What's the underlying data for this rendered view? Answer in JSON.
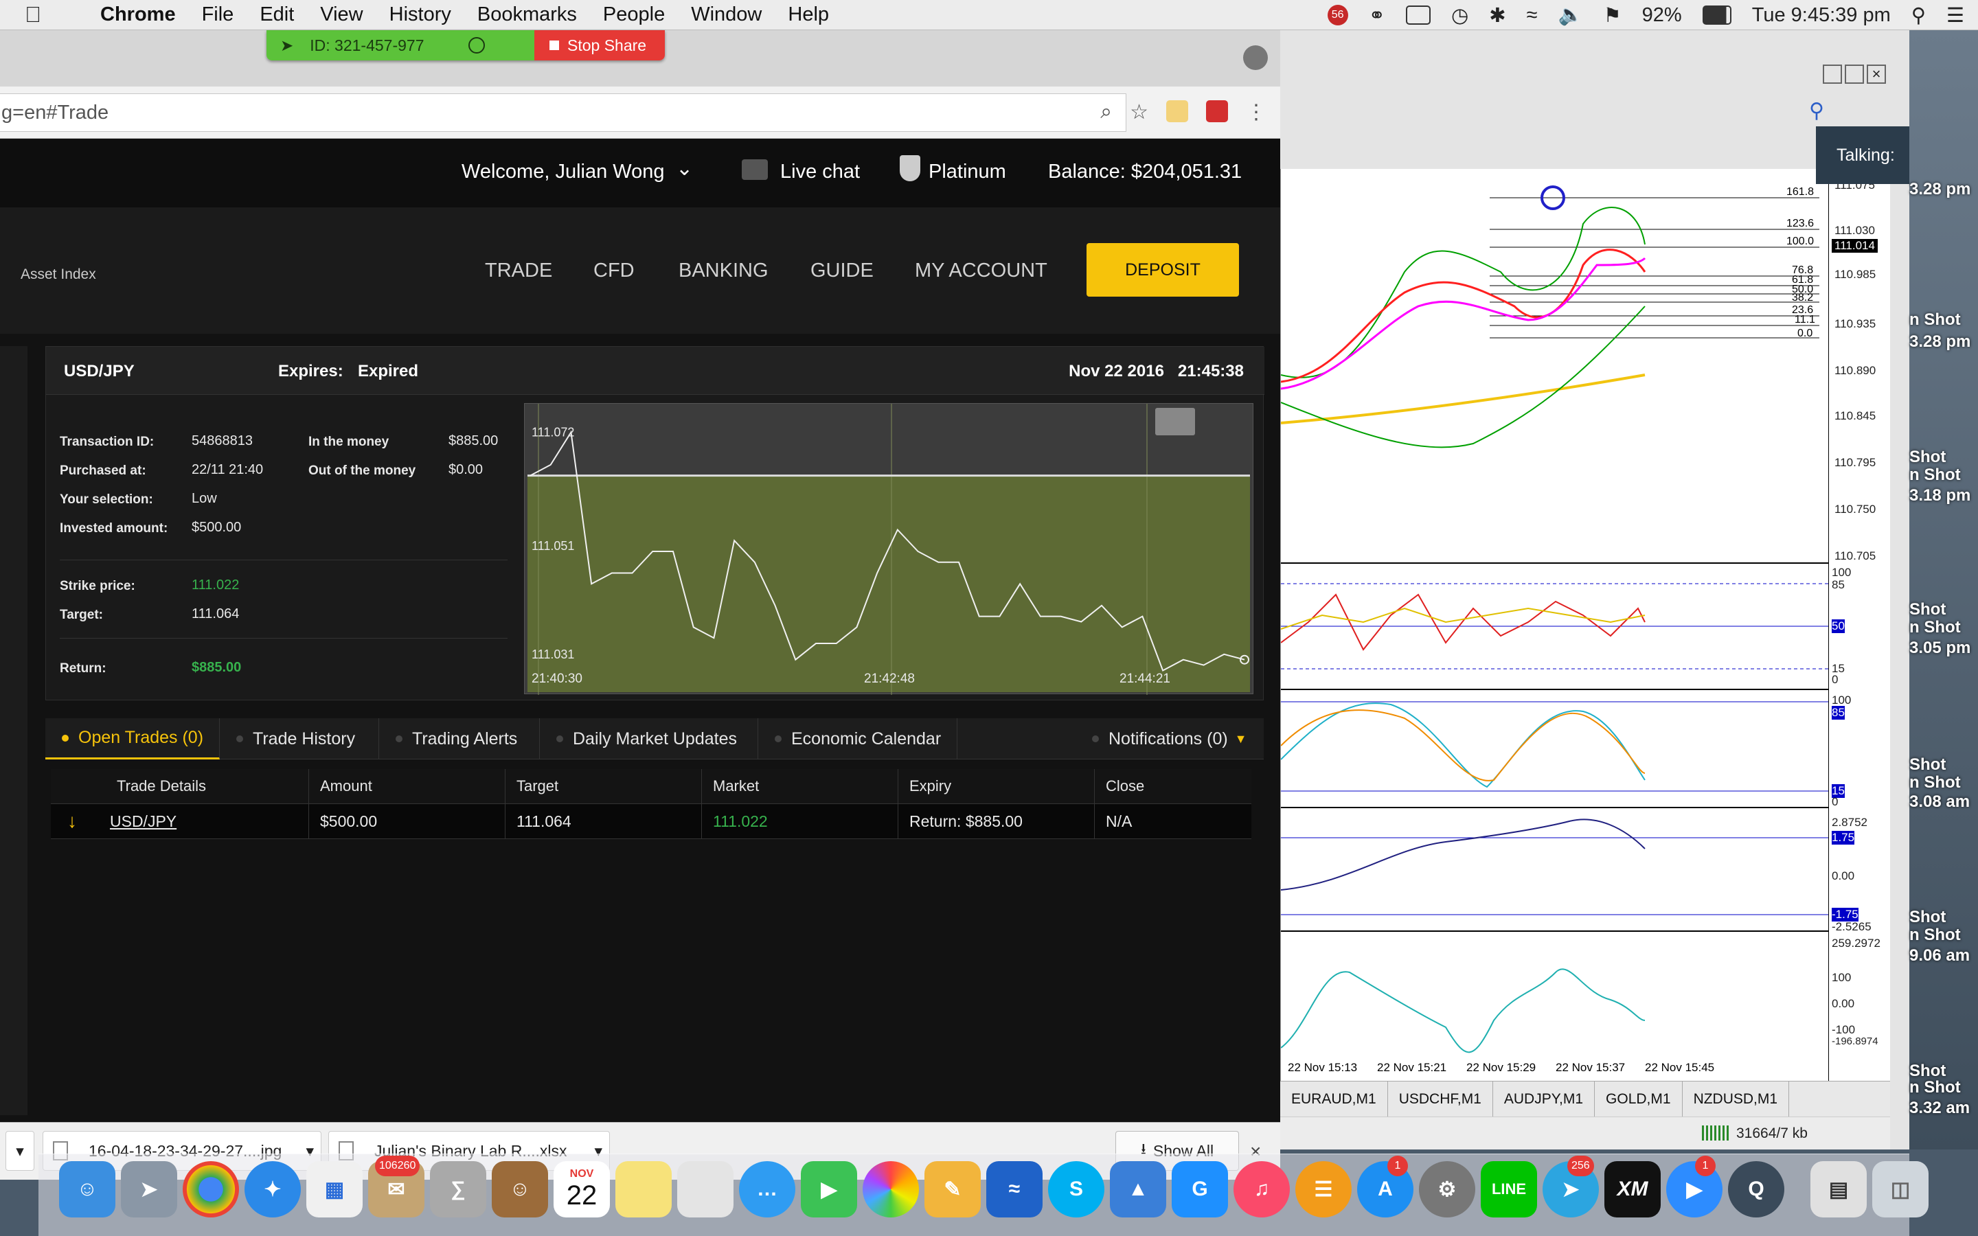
{
  "menubar": {
    "app": "Chrome",
    "items": [
      "File",
      "Edit",
      "View",
      "History",
      "Bookmarks",
      "People",
      "Window",
      "Help"
    ],
    "battery": "92%",
    "clock": "Tue 9:45:39 pm",
    "badge": "56"
  },
  "screen_share": {
    "id_label": "ID: 321-457-977",
    "stop_label": "Stop Share"
  },
  "browser": {
    "url": "g=en#Trade"
  },
  "site": {
    "welcome": "Welcome, Julian Wong",
    "live_chat": "Live chat",
    "tier": "Platinum",
    "balance": "Balance: $204,051.31",
    "asset_index": "Asset Index",
    "nav": [
      "TRADE",
      "CFD",
      "BANKING",
      "GUIDE",
      "MY ACCOUNT"
    ],
    "deposit": "DEPOSIT"
  },
  "trade_card": {
    "pair": "USD/JPY",
    "expires_label": "Expires:",
    "expires_value": "Expired",
    "datetime": "Nov 22 2016   21:45:38",
    "transaction_id_label": "Transaction ID:",
    "transaction_id": "54868813",
    "purchased_label": "Purchased at:",
    "purchased": "22/11 21:40",
    "selection_label": "Your selection:",
    "selection": "Low",
    "invested_label": "Invested amount:",
    "invested": "$500.00",
    "in_money_label": "In the money",
    "in_money": "$885.00",
    "out_money_label": "Out of the money",
    "out_money": "$0.00",
    "strike_label": "Strike price:",
    "strike": "111.022",
    "target_label": "Target:",
    "target": "111.064",
    "return_label": "Return:",
    "return": "$885.00"
  },
  "chart_data": {
    "type": "line",
    "x": [
      "21:40:30",
      "21:42:48",
      "21:44:21"
    ],
    "y_ticks": [
      111.072,
      111.051,
      111.031
    ],
    "title": "",
    "xlabel": "",
    "ylabel": "",
    "target_line": 111.064,
    "grid": true,
    "series": [
      {
        "values": [
          111.064,
          111.066,
          111.072,
          111.044,
          111.046,
          111.046,
          111.05,
          111.05,
          111.036,
          111.034,
          111.052,
          111.048,
          111.04,
          111.03,
          111.033,
          111.033,
          111.036,
          111.046,
          111.054,
          111.05,
          111.048,
          111.048,
          111.038,
          111.038,
          111.044,
          111.038,
          111.038,
          111.037,
          111.04,
          111.036,
          111.038,
          111.028,
          111.03,
          111.029,
          111.031,
          111.03
        ]
      }
    ]
  },
  "tabs": [
    {
      "label": "Open Trades (0)"
    },
    {
      "label": "Trade History"
    },
    {
      "label": "Trading Alerts"
    },
    {
      "label": "Daily Market Updates"
    },
    {
      "label": "Economic Calendar"
    },
    {
      "label": "Notifications (0)"
    }
  ],
  "table": {
    "headers": [
      "Trade Details",
      "Amount",
      "Target",
      "Market",
      "Expiry",
      "Close"
    ],
    "row": {
      "pair": "USD/JPY",
      "amount": "$500.00",
      "target": "111.064",
      "market": "111.022",
      "expiry": "Return: $885.00",
      "close": "N/A"
    }
  },
  "downloads": {
    "items": [
      "16-04-18-23-34-29-27....jpg",
      "Julian's Binary Lab R....xlsx"
    ],
    "show_all": "Show All"
  },
  "mt4": {
    "prices": [
      "111.075",
      "111.030",
      "111.014",
      "110.985",
      "110.935",
      "110.890",
      "110.845",
      "110.795",
      "110.750",
      "110.705"
    ],
    "fib_levels": [
      "161.8",
      "123.6",
      "100.0",
      "76.8",
      "61.8",
      "50.0",
      "38.2",
      "23.6",
      "11.1",
      "0.0"
    ],
    "ind1": [
      "100",
      "85",
      "50",
      "15",
      "0"
    ],
    "ind2": [
      "100",
      "85",
      "15",
      "0"
    ],
    "ind3": [
      "2.8752",
      "1.75",
      "0.00",
      "-1.75",
      "-2.5265"
    ],
    "ind4": [
      "259.2972",
      "100",
      "0.00",
      "-100",
      "-196.8974"
    ],
    "time_labels": [
      "22 Nov 15:13",
      "22 Nov 15:21",
      "22 Nov 15:29",
      "22 Nov 15:37",
      "22 Nov 15:45"
    ],
    "symbol_tabs": [
      "EURAUD,M1",
      "USDCHF,M1",
      "AUDJPY,M1",
      "GOLD,M1",
      "NZDUSD,M1"
    ],
    "status": "31664/7 kb",
    "talking": "Talking:"
  },
  "desktop_labels": [
    "3.28 pm",
    "n Shot",
    "3.28 pm",
    "Shot",
    "n Shot",
    "3.18 pm",
    "Shot",
    "n Shot",
    "3.05 pm",
    "Shot",
    "n Shot",
    "3.08 am",
    "Shot",
    "n Shot",
    "9.06 am",
    "Shot",
    "n Shot",
    "3.32 am"
  ],
  "dock": {
    "mail_badge": "106260",
    "calendar_month": "NOV",
    "calendar_day": "22",
    "appstore_badge": "1",
    "telegram_badge": "256",
    "zoom_badge": "1",
    "xm_label": "XM"
  }
}
